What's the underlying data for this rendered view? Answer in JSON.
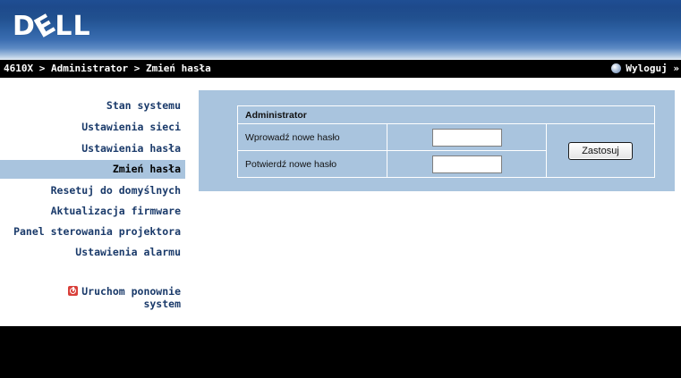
{
  "header": {
    "logo_text": "DELL"
  },
  "breadcrumb": {
    "text": "4610X > Administrator > Zmień hasła",
    "logout_label": "Wyloguj »"
  },
  "sidebar": {
    "items": [
      {
        "label": "Stan systemu",
        "active": false
      },
      {
        "label": "Ustawienia sieci",
        "active": false
      },
      {
        "label": "Ustawienia hasła",
        "active": false
      },
      {
        "label": "Zmień hasła",
        "active": true
      },
      {
        "label": "Resetuj do domyślnych",
        "active": false
      },
      {
        "label": "Aktualizacja firmware",
        "active": false
      },
      {
        "label": "Panel sterowania projektora",
        "active": false
      },
      {
        "label": "Ustawienia alarmu",
        "active": false
      }
    ],
    "restart_line1": "Uruchom ponownie",
    "restart_line2": "system"
  },
  "form": {
    "section_title": "Administrator",
    "new_password_label": "Wprowadź nowe hasło",
    "new_password_value": "",
    "confirm_password_label": "Potwierdź nowe hasło",
    "confirm_password_value": "",
    "apply_label": "Zastosuj"
  },
  "colors": {
    "panel_bg": "#a9c4de",
    "nav_text": "#1a3a6a",
    "bar_bg": "#000000",
    "restart_icon": "#d9403a"
  },
  "icons": {
    "logout": "logout-dot-icon",
    "restart": "power-icon"
  }
}
